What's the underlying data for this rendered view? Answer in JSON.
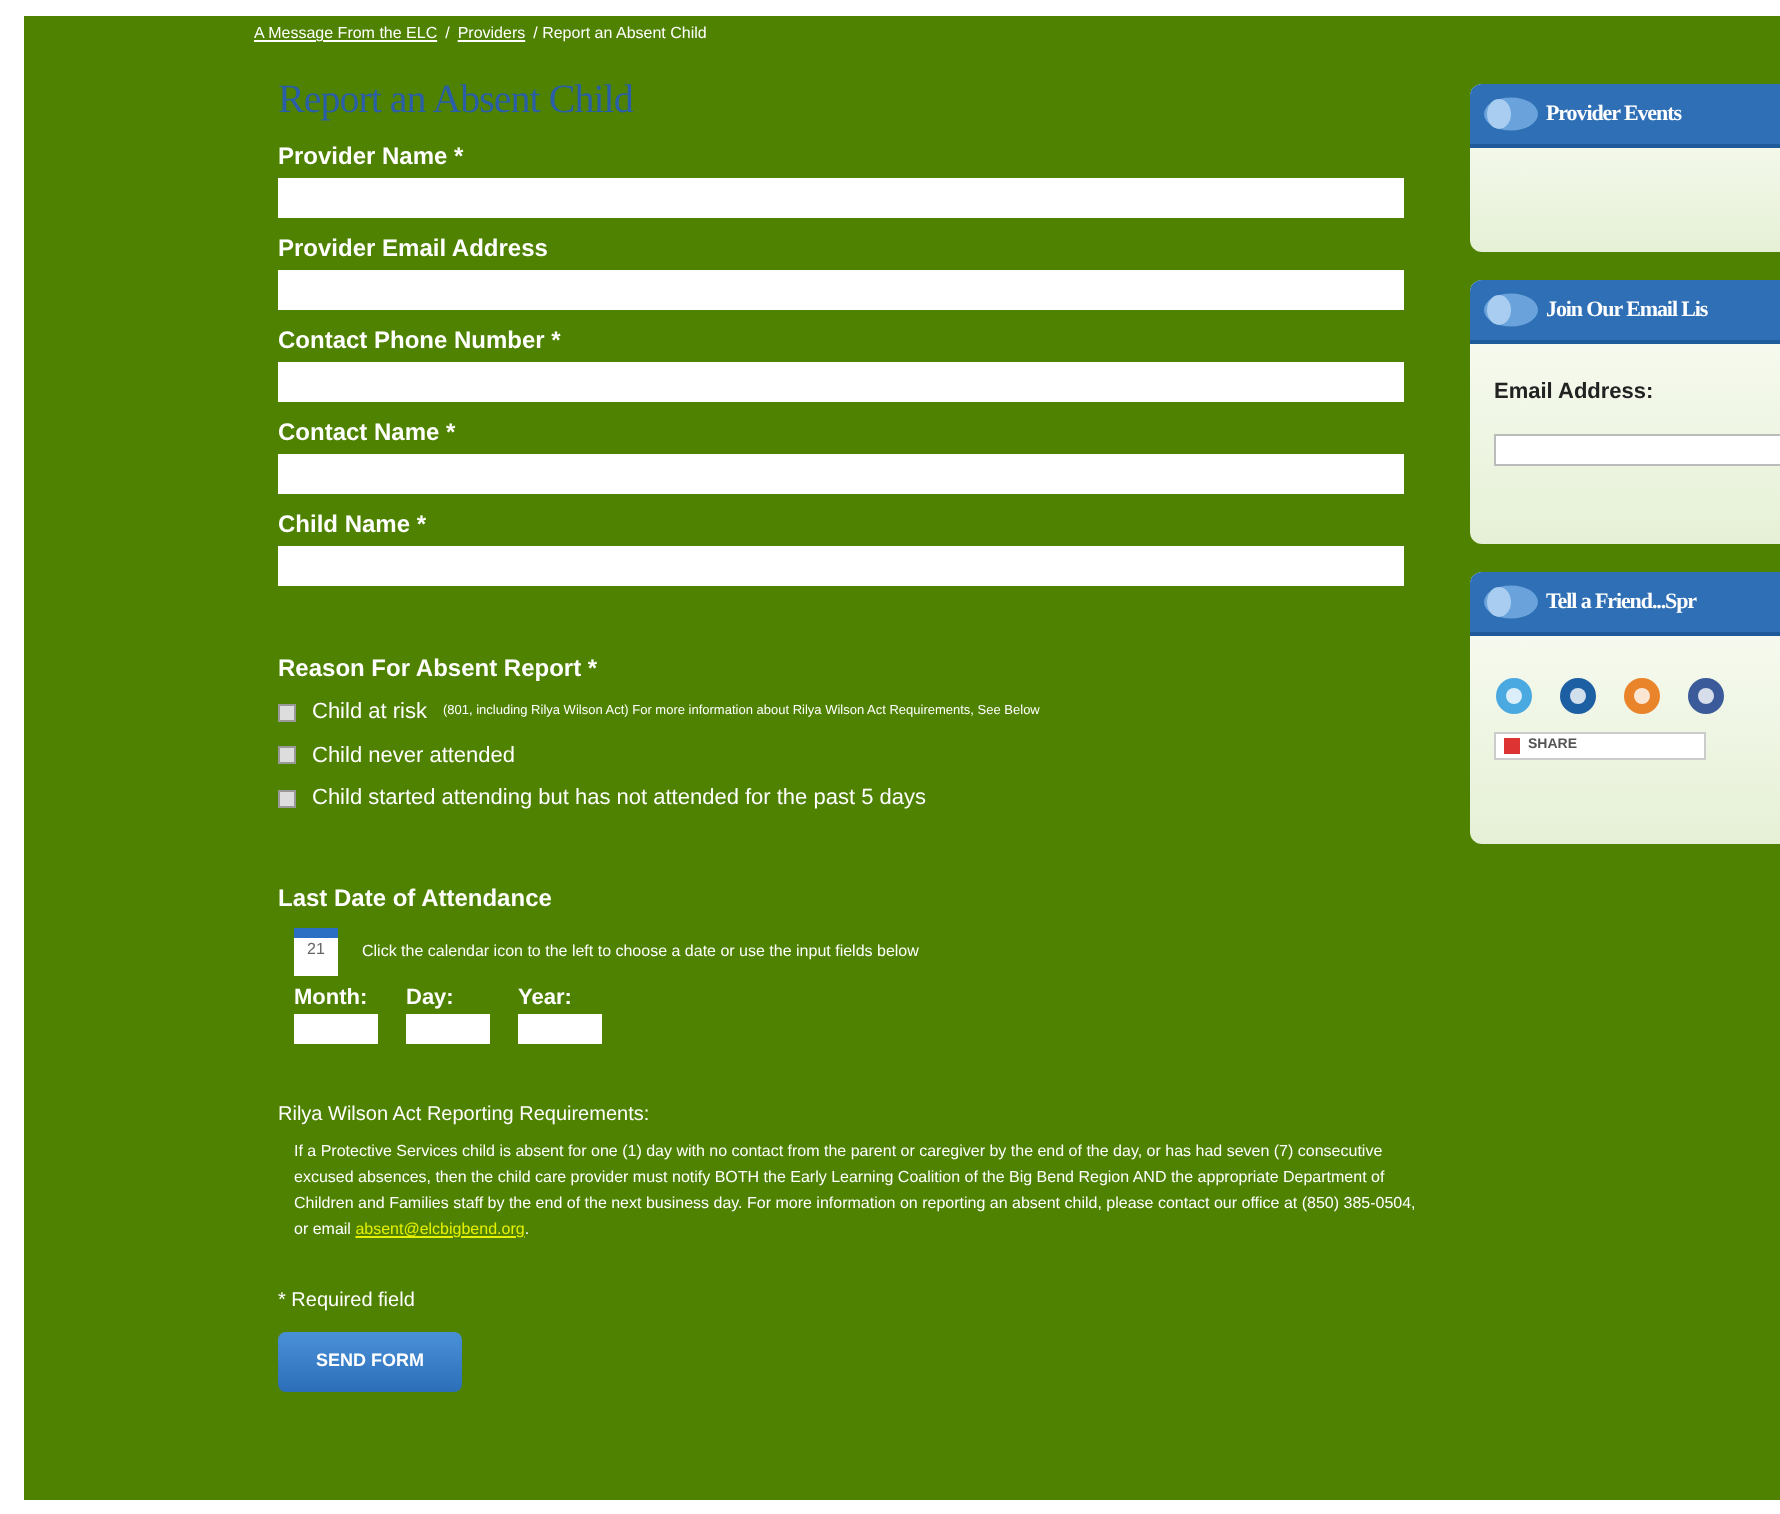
{
  "breadcrumb": [
    {
      "label": "A Message From the ELC",
      "kind": "link"
    },
    {
      "label": "/",
      "kind": "sep"
    },
    {
      "label": "Providers",
      "kind": "link"
    },
    {
      "label": "/ Report an Absent Child",
      "kind": "text"
    }
  ],
  "title": "Report an Absent Child",
  "fields": [
    {
      "label": "Provider Name *"
    },
    {
      "label": "Provider Email Address"
    },
    {
      "label": "Contact Phone Number *"
    },
    {
      "label": "Contact Name *"
    },
    {
      "label": "Child Name *"
    }
  ],
  "reason": {
    "heading": "Reason For Absent Report *",
    "options": [
      {
        "label": "Child at risk",
        "note": "(801, including Rilya Wilson Act) For more information about Rilya Wilson Act Requirements, See Below",
        "checked": false
      },
      {
        "label": "Child never attended",
        "checked": false
      },
      {
        "label": "Child started attending but has not attended for the past 5 days",
        "checked": false
      }
    ]
  },
  "attendance": {
    "heading": "Last Date of Attendance",
    "calendar_day": "21",
    "hint": "Click the calendar icon to the left to choose a date or use the input fields below",
    "date_fields": [
      {
        "label": "Month:"
      },
      {
        "label": "Day:"
      },
      {
        "label": "Year:"
      }
    ]
  },
  "requirements": {
    "heading": "Rilya Wilson Act Reporting Requirements:",
    "body": "If a Protective Services child is absent for one (1) day with no contact from the parent or caregiver by the end of the day, or has had seven (7) consecutive excused absences, then the child care provider must notify BOTH the Early Learning Coalition of the Big Bend Region AND the appropriate Department of Children and Families staff by the end of the next business day. For more information on reporting an absent child, please contact our office at (850) 385-0504, or email",
    "email": "absent@elcbigbend.org",
    "end": "."
  },
  "required_note": "* Required field",
  "submit": "SEND FORM",
  "sidebar": [
    {
      "kind": "events",
      "title": "Provider Events"
    },
    {
      "kind": "email",
      "title": "Join Our Email Lis",
      "label": "Email Address:"
    },
    {
      "kind": "share",
      "title": "Tell a Friend...Spr",
      "share_label": "SHARE"
    }
  ]
}
